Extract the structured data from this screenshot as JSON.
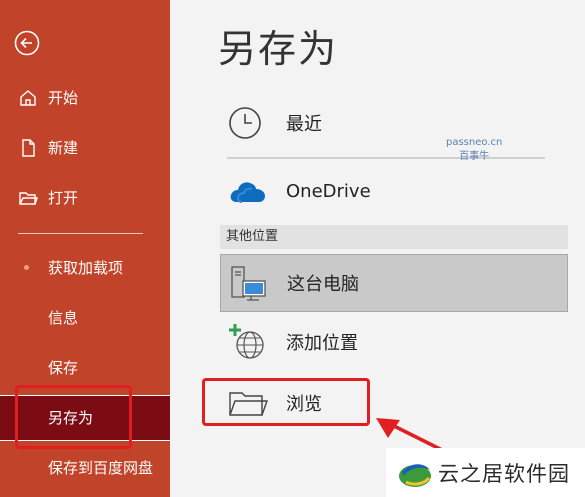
{
  "sidebar": {
    "back_icon": "back-arrow-icon",
    "items": [
      {
        "label": "开始",
        "icon": "home-icon"
      },
      {
        "label": "新建",
        "icon": "new-document-icon"
      },
      {
        "label": "打开",
        "icon": "open-folder-icon"
      },
      {
        "label": "获取加载项"
      },
      {
        "label": "信息"
      },
      {
        "label": "保存"
      },
      {
        "label": "另存为",
        "active": true
      },
      {
        "label": "保存到百度网盘"
      }
    ]
  },
  "main": {
    "title": "另存为",
    "recent_label": "最近",
    "onedrive_label": "OneDrive",
    "section_header": "其他位置",
    "this_pc_label": "这台电脑",
    "add_place_label": "添加位置",
    "browse_label": "浏览"
  },
  "watermark": {
    "line1": "passneo.cn",
    "line2": "百事牛"
  },
  "brand": {
    "name": "云之居软件园"
  },
  "colors": {
    "sidebar": "#c0432a",
    "active_item": "#7c0c14",
    "highlight": "#e02020",
    "onedrive": "#0f6cbd"
  }
}
